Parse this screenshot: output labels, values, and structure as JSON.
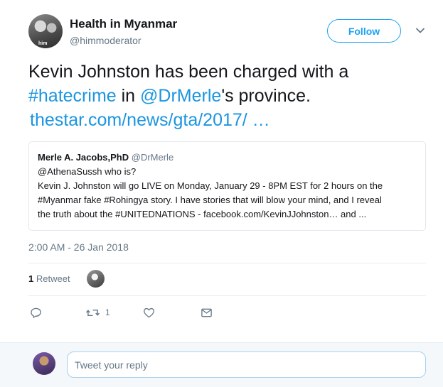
{
  "author": {
    "name": "Health in Myanmar",
    "handle": "@himmoderator",
    "avatar_tag": "him"
  },
  "header": {
    "follow_label": "Follow"
  },
  "tweet": {
    "text_part1": "Kevin Johnston has been charged with a ",
    "hashtag": "#hatecrime",
    "text_part2": " in ",
    "mention": "@DrMerle",
    "text_part3": "'s province.",
    "link": "thestar.com/news/gta/2017/  …"
  },
  "quoted_tweet": {
    "name": "Merle A. Jacobs,PhD",
    "handle": "@DrMerle",
    "line1": "@AthenaSussh who is?",
    "line2": "Kevin J. Johnston will go LIVE on Monday, January 29 - 8PM EST for 2 hours on the",
    "line3": "#Myanmar fake #Rohingya story. I have stories that will blow your mind, and I reveal",
    "line4": "the truth about the #UNITEDNATIONS - facebook.com/KevinJJohnston… and ..."
  },
  "timestamp": "2:00 AM - 26 Jan 2018",
  "stats": {
    "retweet_count": "1",
    "retweet_label": "Retweet"
  },
  "actions": {
    "retweet_count": "1"
  },
  "reply": {
    "placeholder": "Tweet your reply"
  },
  "colors": {
    "accent": "#1da1f2",
    "link": "#1b95e0",
    "secondary_text": "#657786",
    "divider": "#e6ecf0"
  },
  "icons": [
    "chevron-down-icon",
    "reply-icon",
    "retweet-icon",
    "like-icon",
    "direct-message-icon"
  ]
}
